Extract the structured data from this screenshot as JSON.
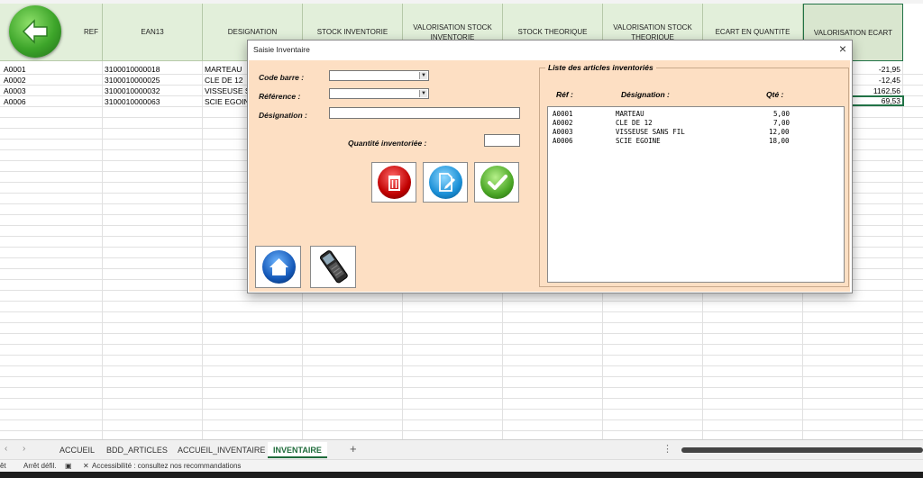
{
  "sheet": {
    "headers": [
      "REF",
      "EAN13",
      "DESIGNATION",
      "STOCK INVENTORIE",
      "VALORISATION STOCK INVENTORIE",
      "STOCK THEORIQUE",
      "VALORISATION STOCK THEORIQUE",
      "ECART EN QUANTITE",
      "VALORISATION ECART"
    ],
    "rows": [
      {
        "ref": "A0001",
        "ean": "3100010000018",
        "designation": "MARTEAU",
        "valeur": "-21,95"
      },
      {
        "ref": "A0002",
        "ean": "3100010000025",
        "designation": "CLE DE 12",
        "valeur": "-12,45"
      },
      {
        "ref": "A0003",
        "ean": "3100010000032",
        "designation": "VISSEUSE SA",
        "valeur": "1162,56"
      },
      {
        "ref": "A0006",
        "ean": "3100010000063",
        "designation": "SCIE EGOINE",
        "valeur": "69,53"
      }
    ]
  },
  "tabs": {
    "items": [
      "ACCUEIL",
      "BDD_ARTICLES",
      "ACCUEIL_INVENTAIRE",
      "INVENTAIRE"
    ],
    "active": "INVENTAIRE",
    "add": "+",
    "prev": "‹",
    "next": "›",
    "more": "⋮"
  },
  "status": {
    "left": "êt",
    "scroll": "Arrêt défil.",
    "accessibility": "Accessibilité : consultez nos recommandations"
  },
  "dialog": {
    "title": "Saisie Inventaire",
    "close": "×",
    "labels": {
      "code_barre": "Code barre :",
      "reference": "Référence :",
      "designation": "Désignation :",
      "quantite": "Quantité inventoriée :"
    },
    "list": {
      "title": "Liste des articles inventoriés",
      "col_ref": "Réf :",
      "col_designation": "Désignation :",
      "col_qte": "Qté :",
      "items": [
        {
          "ref": "A0001",
          "designation": "MARTEAU",
          "qte": "5,00"
        },
        {
          "ref": "A0002",
          "designation": "CLE DE 12",
          "qte": "7,00"
        },
        {
          "ref": "A0003",
          "designation": "VISSEUSE SANS FIL",
          "qte": "12,00"
        },
        {
          "ref": "A0006",
          "designation": "SCIE EGOINE",
          "qte": "18,00"
        }
      ]
    }
  },
  "colors": {
    "header_bg": "#e2efda",
    "dialog_bg": "#fddfc3",
    "excel_green": "#217346"
  },
  "icons": [
    "back-arrow-icon",
    "trash-icon",
    "edit-document-icon",
    "checkmark-icon",
    "home-icon",
    "barcode-scanner-icon"
  ]
}
